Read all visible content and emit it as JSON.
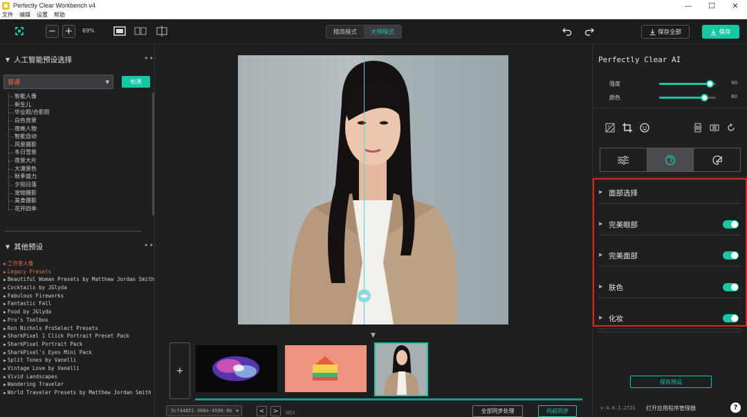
{
  "window": {
    "title": "Perfectly Clear Workbench v4",
    "minimize": "—",
    "maximize": "☐",
    "close": "✕"
  },
  "menu": [
    "文件",
    "编辑",
    "设置",
    "帮助"
  ],
  "toolbar": {
    "zoom_out": "−",
    "zoom_in": "+",
    "zoom_level": "69%",
    "mode_simple": "精简模式",
    "mode_master": "大师模式",
    "save_all": "保存全部",
    "save": "保存"
  },
  "left": {
    "ai_presets_title": "人工智能预设选择",
    "preset_selected": "普通",
    "detect_button": "检测",
    "ai_presets": [
      "智能人像",
      "新生儿",
      "毕业照/合影照",
      "白色背景",
      "夜晚人物",
      "智能自动",
      "风景摄影",
      "冬日雪景",
      "夜景大片",
      "大漠景色",
      "秋季盛力",
      "夕阳日落",
      "宠物摄影",
      "美食摄影",
      "花开四季"
    ],
    "other_presets_title": "其他预设",
    "other_presets": [
      {
        "label": "工作室人像",
        "highlight": true
      },
      {
        "label": "Legacy Presets",
        "highlight": true
      },
      {
        "label": "Beautiful Woman Presets by Matthew Jordan Smith",
        "highlight": false
      },
      {
        "label": "Cocktails by JGlyda",
        "highlight": false
      },
      {
        "label": "Fabulous Fireworks",
        "highlight": false
      },
      {
        "label": "Fantastic Fall",
        "highlight": false
      },
      {
        "label": "Food by JGlyda",
        "highlight": false
      },
      {
        "label": "Pro's Toolbox",
        "highlight": false
      },
      {
        "label": "Ron Nichols ProSelect Presets",
        "highlight": false
      },
      {
        "label": "SharkPixel 1 Click Portrait Preset Pack",
        "highlight": false
      },
      {
        "label": "SharkPixel Portrait Pack",
        "highlight": false
      },
      {
        "label": "SharkPixel's Eyes Mini Pack",
        "highlight": false
      },
      {
        "label": "Split Tones by Vanelli",
        "highlight": false
      },
      {
        "label": "Vintage Love by Vanelli",
        "highlight": false
      },
      {
        "label": "Vivid Landscapes",
        "highlight": false
      },
      {
        "label": "Wandering Traveler",
        "highlight": false
      },
      {
        "label": "World Traveler Presets by Matthew Jordan Smith",
        "highlight": false
      }
    ]
  },
  "canvas": {
    "add_image": "+",
    "file_hash": "3cf44851-368a-4596-8b",
    "prev": "<",
    "next": ">",
    "page_count": "3的3",
    "batch_button": "全部同步处理",
    "sync_button": "向前同步"
  },
  "right": {
    "title": "Perfectly Clear AI",
    "sliders": [
      {
        "label": "强度",
        "value": "90",
        "level": 0.9
      },
      {
        "label": "颜色",
        "value": "80",
        "level": 0.8
      }
    ],
    "features": [
      {
        "label": "面部选择",
        "toggle": false
      },
      {
        "label": "完美眼部",
        "toggle": true
      },
      {
        "label": "完美面部",
        "toggle": true
      },
      {
        "label": "肤色",
        "toggle": true
      },
      {
        "label": "化妆",
        "toggle": true
      }
    ],
    "save_preset": "保存预设",
    "version": "v:4.6.1.2721",
    "app_manager": "打开应用程序管理器",
    "help": "?"
  },
  "colors": {
    "accent": "#15c7a2",
    "highlight": "#e8723a",
    "redbox": "#e0261f"
  }
}
